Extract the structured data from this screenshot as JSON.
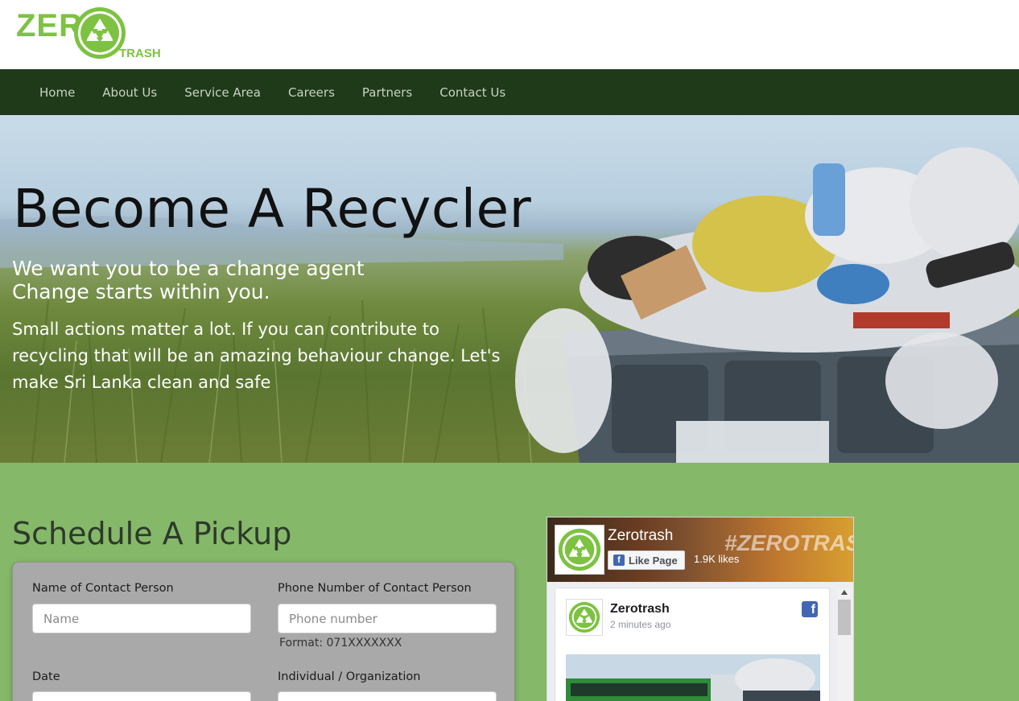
{
  "logo": {
    "part1": "ZER",
    "part2": "TRASH"
  },
  "nav": {
    "items": [
      "Home",
      "About Us",
      "Service Area",
      "Careers",
      "Partners",
      "Contact Us"
    ]
  },
  "hero": {
    "title": "Become A Recycler",
    "subtitle1": "We want you to be a change agent",
    "subtitle2": "Change starts within you.",
    "paragraph": "Small actions matter a lot. If you can contribute to recycling that will be an amazing behaviour change. Let's make Sri Lanka clean and safe"
  },
  "schedule": {
    "title": "Schedule A Pickup",
    "fields": {
      "name_label": "Name of Contact Person",
      "name_placeholder": "Name",
      "phone_label": "Phone Number of Contact Person",
      "phone_placeholder": "Phone number",
      "phone_hint": "Format: 071XXXXXXX",
      "date_label": "Date",
      "type_label": "Individual / Organization"
    }
  },
  "facebook": {
    "page_name": "Zerotrash",
    "like_label": "Like Page",
    "likes": "1.9K likes",
    "cover_text": "#ZEROTRASH",
    "post_name": "Zerotrash",
    "post_time": "2 minutes ago"
  },
  "colors": {
    "brand_green": "#7dc242",
    "nav_bg": "#1f3a18",
    "section_bg": "#86b86a",
    "fb_blue": "#4267b2"
  }
}
